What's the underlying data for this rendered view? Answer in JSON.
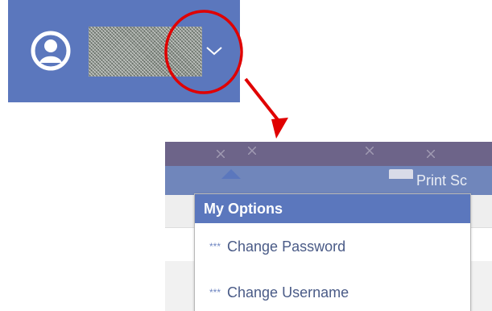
{
  "user_bar": {
    "background_color": "#5b77bd",
    "avatar_icon": "user-circle-icon",
    "chevron_icon": "chevron-down-icon",
    "highlight_color": "#e00000"
  },
  "toolbar": {
    "print_label": "Print Sc"
  },
  "dropdown": {
    "header": "My Options",
    "items": [
      {
        "icon": "***",
        "label": "Change Password"
      },
      {
        "icon": "***",
        "label": "Change Username"
      }
    ]
  },
  "colors": {
    "accent": "#5b77bd",
    "purple_band": "#6d6489",
    "menu_text": "#4a5b87"
  }
}
